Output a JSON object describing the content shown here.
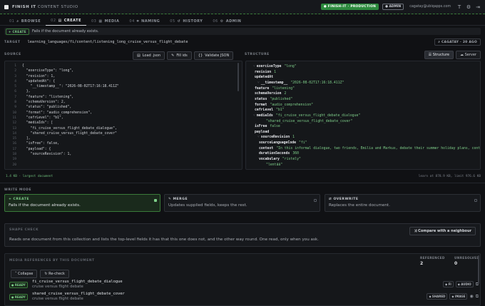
{
  "app": {
    "title_bold": "FINISH IT",
    "title_rest": " CONTENT STUDIO",
    "env": "● FINISH-IT · PRODUCTION",
    "role": "● ADMIN",
    "email": "cagatay@ubiqapps.com"
  },
  "tabs": [
    {
      "num": "01",
      "label": "BROWSE",
      "icon": "⌕"
    },
    {
      "num": "02",
      "label": "CREATE",
      "icon": "▤"
    },
    {
      "num": "03",
      "label": "MEDIA",
      "icon": "▦"
    },
    {
      "num": "04",
      "label": "NAMING",
      "icon": "⌗"
    },
    {
      "num": "05",
      "label": "HISTORY",
      "icon": "↺"
    },
    {
      "num": "06",
      "label": "ADMIN",
      "icon": "⚙"
    }
  ],
  "banner": {
    "chip": "+ CREATE",
    "text": "Fails if the document already exists."
  },
  "target": {
    "label": "TARGET",
    "path": "learning_languages/fi/content/listening_long_cruise_versus_flight_debate",
    "catalog": "⌕ CAGATAY · 20 AGO"
  },
  "source": {
    "label": "SOURCE",
    "load": "Load .json",
    "fill": "Fill ids",
    "validate": "Validate JSON",
    "lines": [
      "{",
      "  \"exerciseType\": \"long\",",
      "  \"revision\": 1,",
      "  \"updatedAt\": {",
      "    \"__timestamp__\": \"2026-08-02T17:16:18.411Z\"",
      "  },",
      "  \"feature\": \"listening\",",
      "  \"schemaVersion\": 2,",
      "  \"status\": \"published\",",
      "  \"format\": \"audio_comprehension\",",
      "  \"cefrLevel\": \"b1\",",
      "  \"mediaIds\": [",
      "    \"fi_cruise_versus_flight_debate_dialogue\",",
      "    \"shared_cruise_versus_flight_debate_cover\"",
      "  ],",
      "  \"isFree\": false,",
      "  \"payload\": {",
      "    \"sourceRevision\": 1,"
    ],
    "numbers": [
      "1",
      "2",
      "3",
      "4",
      "5",
      "6",
      "7",
      "8",
      "9",
      "10",
      "11",
      "12",
      "13",
      "14",
      "15",
      "16",
      "17",
      "18",
      "19",
      "20"
    ]
  },
  "structure": {
    "label": "STRUCTURE",
    "view_structure": "☰ Structure",
    "view_server": "☁ Server",
    "rows": [
      {
        "k": "exerciseType",
        "v": "\"long\"",
        "c": "˅",
        "ind": 0
      },
      {
        "k": "revision",
        "v": "1",
        "c": "",
        "ind": 0
      },
      {
        "k": "updatedAt",
        "v": "",
        "c": "",
        "ind": 0
      },
      {
        "k": "__timestamp__",
        "v": "\"2026-08-02T17:16:18.411Z\"",
        "c": "˅",
        "ind": 1
      },
      {
        "k": "feature",
        "v": "\"listening\"",
        "c": "",
        "ind": 0
      },
      {
        "k": "schemaVersion",
        "v": "2",
        "c": "",
        "ind": 0
      },
      {
        "k": "status",
        "v": "\"published\"",
        "c": "",
        "ind": 0
      },
      {
        "k": "format",
        "v": "\"audio_comprehension\"",
        "c": "",
        "ind": 0
      },
      {
        "k": "cefrLevel",
        "v": "\"b1\"",
        "c": "",
        "ind": 0
      },
      {
        "k": "mediaIds",
        "v": "\"fi_cruise_versus_flight_debate_dialogue\"",
        "c": "˅",
        "ind": 0
      },
      {
        "k": "",
        "v": "\"shared_cruise_versus_flight_debate_cover\"",
        "c": "",
        "ind": 2
      },
      {
        "k": "isFree",
        "v": "false",
        "c": "",
        "ind": 0
      },
      {
        "k": "payload",
        "v": "",
        "c": "",
        "ind": 0
      },
      {
        "k": "sourceRevision",
        "v": "1",
        "c": "˅",
        "ind": 1
      },
      {
        "k": "sourceLanguageCode",
        "v": "\"fi\"",
        "c": "",
        "ind": 1
      },
      {
        "k": "context",
        "v": "\"In this informal dialogue, two friends, Emilia and Markus, debate their summer holiday plans, contrasting the relaxation of",
        "c": "",
        "ind": 1
      },
      {
        "k": "durationSeconds",
        "v": "360",
        "c": "",
        "ind": 1
      },
      {
        "k": "vocabulary",
        "v": "\"ristely\"",
        "c": "",
        "ind": 1
      },
      {
        "k": "",
        "v": "\"lentää\"",
        "c": "",
        "ind": 2
      }
    ],
    "size_left": "1.4 KB · largest document",
    "size_right": "learn at 878.9 KB, limit 976.6 KB"
  },
  "write_mode": {
    "label": "WRITE MODE",
    "modes": [
      {
        "title": "+ CREATE",
        "desc": "Fails if the document already exists."
      },
      {
        "title": "✎ MERGE",
        "desc": "Updates supplied fields, keeps the rest."
      },
      {
        "title": "⇄ OVERWRITE",
        "desc": "Replaces the entire document."
      }
    ]
  },
  "shape": {
    "label": "SHAPE CHECK",
    "desc": "Reads one document from this collection and lists the top-level fields it has that this one does not, and the other way round. One read, only when you ask.",
    "compare": "⤨ Compare with a neighbour"
  },
  "refs": {
    "label": "MEDIA REFERENCES BY THIS DOCUMENT",
    "referenced_label": "REFERENCED",
    "referenced": "2",
    "unresolved_label": "UNRESOLVED",
    "unresolved": "0",
    "collapse": "˅ Collapse",
    "recheck": "↻ Re-check",
    "items": [
      {
        "status": "● READY",
        "name": "fi_cruise_versus_flight_debate_dialogue",
        "sub": "cruise versus flight debate",
        "tags": [
          "◆ FI",
          "◆ AUDIO"
        ]
      },
      {
        "status": "● READY",
        "name": "shared_cruise_versus_flight_debate_cover",
        "sub": "cruise versus flight debate",
        "tags": [
          "◆ SHARED",
          "◆ IMAGE"
        ]
      }
    ]
  }
}
